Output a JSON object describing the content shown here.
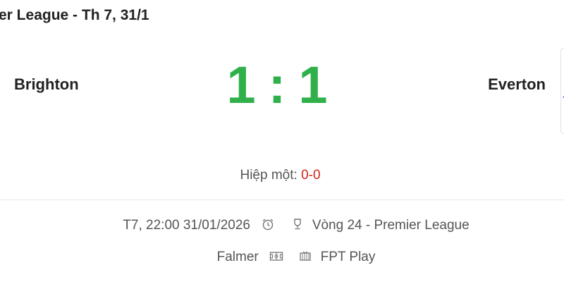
{
  "header": {
    "title": "er League - Th 7, 31/1"
  },
  "match": {
    "home_team": "Brighton",
    "away_team": "Everton",
    "home_score": "1",
    "away_score": "1",
    "score_separator": ":",
    "halftime_label": "Hiệp một:",
    "halftime_score": "0-0"
  },
  "details": {
    "datetime": "T7, 22:00 31/01/2026",
    "round": "Vòng 24 - Premier League",
    "venue": "Falmer",
    "broadcaster": "FPT Play"
  },
  "icons": {
    "datetime": "alarm-clock-icon",
    "round": "trophy-icon",
    "venue": "stadium-pitch-icon",
    "broadcaster": "tv-icon"
  },
  "colors": {
    "score": "#2fb04a",
    "halftime_score": "#d0241b"
  }
}
